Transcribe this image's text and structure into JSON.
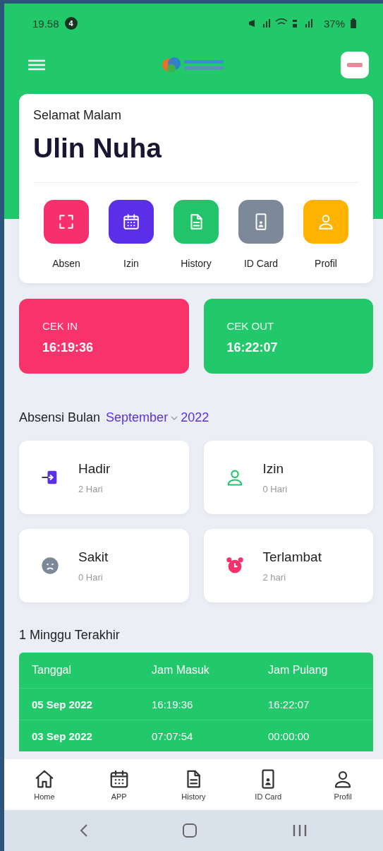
{
  "status_bar": {
    "time": "19.58",
    "notification_count": "4",
    "battery": "37%"
  },
  "greeting": "Selamat Malam",
  "user_name": "Ulin Nuha",
  "menu": [
    {
      "kind": "scan",
      "label": "Absen",
      "color": "#f5306a"
    },
    {
      "kind": "calendar",
      "label": "Izin",
      "color": "#5b2ee8"
    },
    {
      "kind": "document",
      "label": "History",
      "color": "#22c469"
    },
    {
      "kind": "id-card",
      "label": "ID Card",
      "color": "#7d8898"
    },
    {
      "kind": "person",
      "label": "Profil",
      "color": "#ffb300"
    }
  ],
  "checks": [
    {
      "label": "CEK IN",
      "time": "16:19:36",
      "color": "#f8326a"
    },
    {
      "label": "CEK OUT",
      "time": "16:22:07",
      "color": "#22c96b"
    }
  ],
  "month_section": {
    "title": "Absensi Bulan",
    "month": "September",
    "year": "2022"
  },
  "stats": [
    {
      "kind": "enter",
      "label": "Hadir",
      "value": "2 Hari"
    },
    {
      "kind": "person",
      "label": "Izin",
      "value": "0 Hari"
    },
    {
      "kind": "sad",
      "label": "Sakit",
      "value": "0 Hari"
    },
    {
      "kind": "alarm",
      "label": "Terlambat",
      "value": "2 hari"
    }
  ],
  "week": {
    "title": "1 Minggu Terakhir",
    "columns": [
      "Tanggal",
      "Jam Masuk",
      "Jam Pulang"
    ],
    "rows": [
      [
        "05 Sep 2022",
        "16:19:36",
        "16:22:07"
      ],
      [
        "03 Sep 2022",
        "07:07:54",
        "00:00:00"
      ]
    ]
  },
  "bottom_nav": [
    {
      "kind": "home",
      "label": "Home"
    },
    {
      "kind": "calendar",
      "label": "APP"
    },
    {
      "kind": "document",
      "label": "History"
    },
    {
      "kind": "id-card",
      "label": "ID Card"
    },
    {
      "kind": "person",
      "label": "Profil"
    }
  ]
}
